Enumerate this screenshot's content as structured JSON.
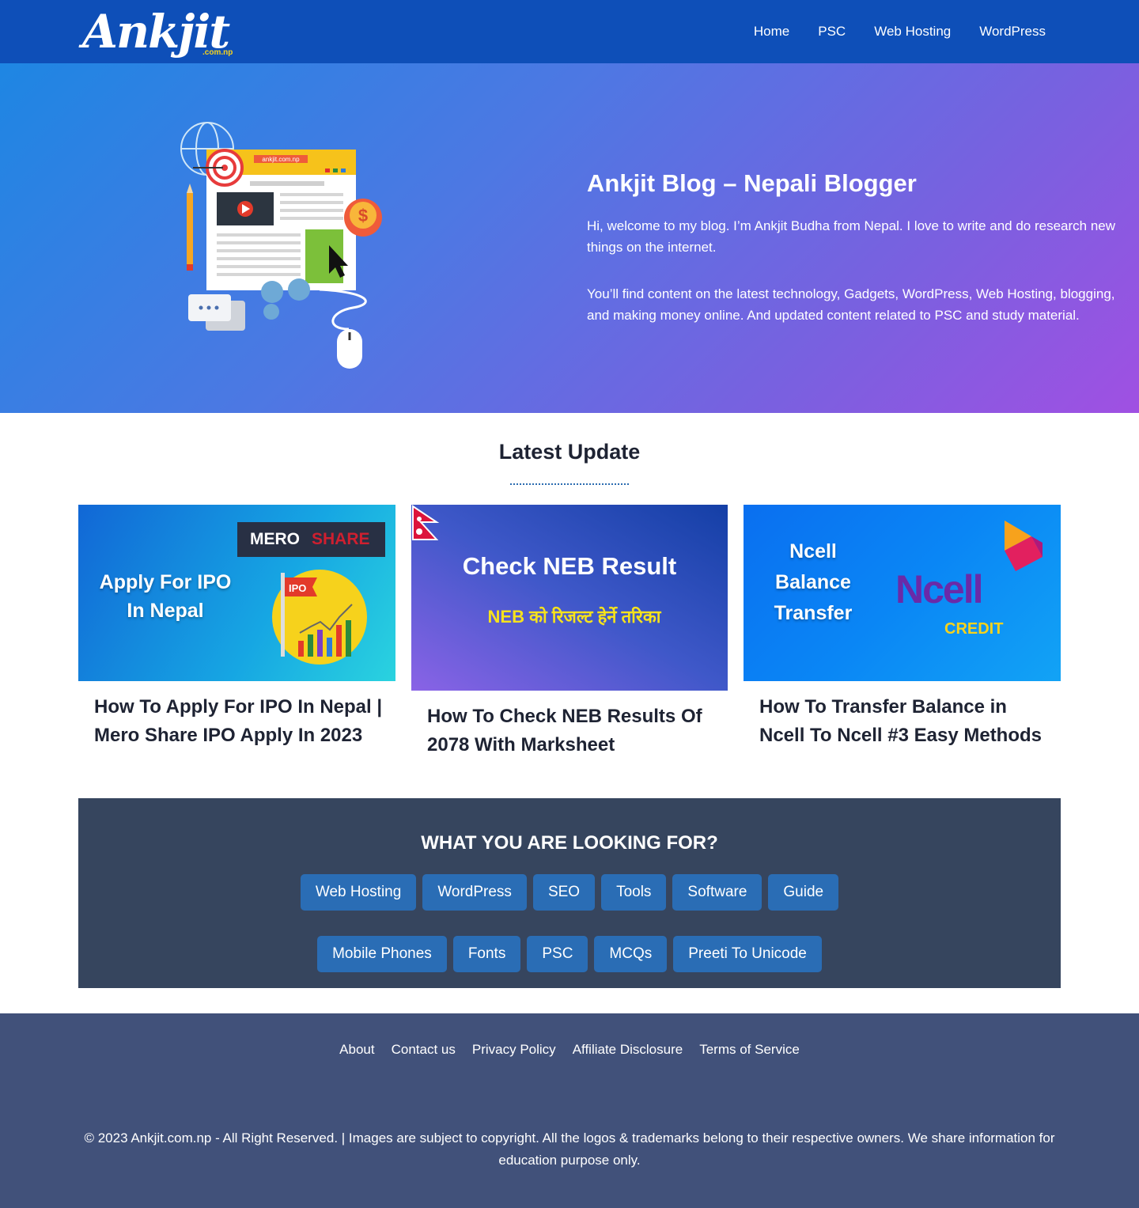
{
  "header": {
    "logo_text": "Ankjit",
    "logo_sub": ".com.np",
    "nav": [
      "Home",
      "PSC",
      "Web Hosting",
      "WordPress"
    ]
  },
  "hero": {
    "illustration_label": "ankjit.com.np",
    "title": "Ankjit Blog – Nepali Blogger",
    "p1": "Hi, welcome to my blog. I’m Ankjit Budha from Nepal. I love to write and do research new things on the internet.",
    "p2": "You’ll find content on the latest technology, Gadgets, WordPress, Web Hosting, blogging, and making money online. And updated content related to PSC and study material."
  },
  "latest": {
    "heading": "Latest Update",
    "cards": [
      {
        "img_line1": "Apply For IPO",
        "img_line2": "In Nepal",
        "img_badge1": "MERO",
        "img_badge2": "SHARE",
        "img_flag": "IPO",
        "title": "How To Apply For IPO In Nepal | Mero Share IPO Apply In 2023"
      },
      {
        "img_line1": "Check NEB Result",
        "img_line2": "NEB को रिजल्ट हेर्ने तरिका",
        "title": "How To Check NEB Results Of 2078 With Marksheet"
      },
      {
        "img_line1": "Ncell",
        "img_line2": "Balance",
        "img_line3": "Transfer",
        "img_brand": "Ncell",
        "img_sub": "CREDIT",
        "title": "How To Transfer Balance in Ncell To Ncell #3 Easy Methods"
      }
    ]
  },
  "looking": {
    "heading": "WHAT YOU ARE LOOKING FOR?",
    "row1": [
      "Web Hosting",
      "WordPress",
      "SEO",
      "Tools",
      "Software",
      "Guide"
    ],
    "row2": [
      "Mobile Phones",
      "Fonts",
      "PSC",
      "MCQs",
      "Preeti To Unicode"
    ]
  },
  "footer": {
    "links": [
      "About",
      "Contact us",
      "Privacy Policy",
      "Affiliate Disclosure",
      "Terms of Service"
    ],
    "copyright": "© 2023 Ankjit.com.np - All Right Reserved. |  Images are subject to copyright. All the logos & trademarks belong to their respective owners. We share information for education purpose only."
  },
  "colors": {
    "header": "#0e4fb8",
    "accent": "#2a6db5",
    "dark_panel": "#36455e",
    "footer": "#41517a"
  }
}
